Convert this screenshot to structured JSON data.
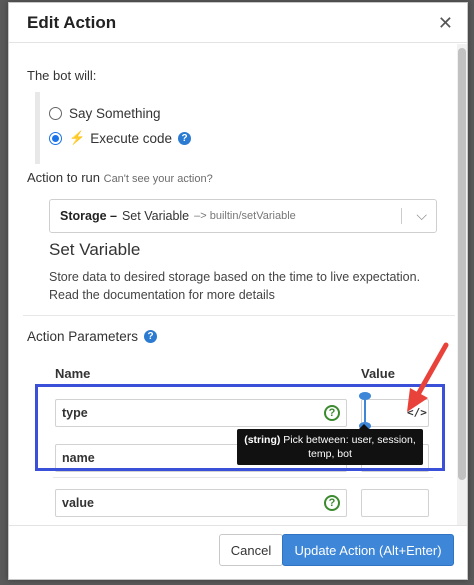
{
  "dialog": {
    "title": "Edit Action",
    "close_icon": "close-icon"
  },
  "bot_will": {
    "label": "The bot will:",
    "options": [
      {
        "label": "Say Something",
        "selected": false
      },
      {
        "label": "Execute code",
        "selected": true
      }
    ]
  },
  "action_to_run": {
    "label": "Action to run",
    "hint": "Can't see your action?",
    "select": {
      "category": "Storage –",
      "name": "Set Variable",
      "path": "–> builtin/setVariable"
    },
    "title": "Set Variable",
    "description": "Store data to desired storage based on the time to live expectation. Read the documentation for more details"
  },
  "params": {
    "label": "Action Parameters",
    "columns": {
      "name": "Name",
      "value": "Value"
    },
    "rows": [
      {
        "name": "type",
        "value": ""
      },
      {
        "name": "name",
        "value": ""
      },
      {
        "name": "value",
        "value": ""
      }
    ],
    "help_glyph": "?",
    "code_glyph": "</>"
  },
  "tooltip": {
    "type": "(string)",
    "text": "Pick between: user, session, temp, bot"
  },
  "footer": {
    "cancel": "Cancel",
    "update": "Update Action (Alt+Enter)"
  },
  "colors": {
    "accent": "#3d86d8",
    "highlight_box": "#3b50d8",
    "annotation_arrow": "#e8423a",
    "help_green": "#3b8b2e"
  }
}
